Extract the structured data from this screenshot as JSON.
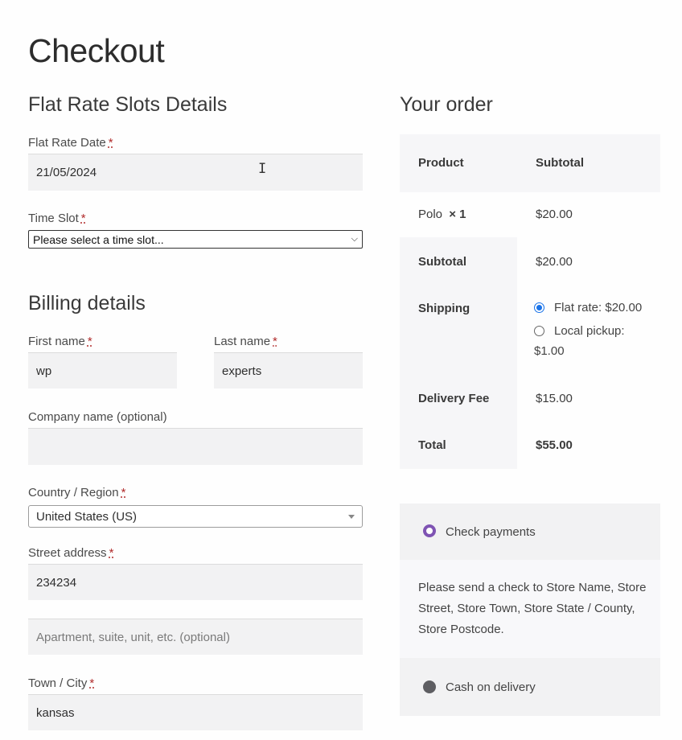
{
  "page": {
    "title": "Checkout"
  },
  "slots": {
    "heading": "Flat Rate Slots Details",
    "date_label": "Flat Rate Date",
    "date_value": "21/05/2024",
    "time_label": "Time Slot",
    "time_selected": "Please select a time slot...",
    "required_mark": "*"
  },
  "billing": {
    "heading": "Billing details",
    "first_name_label": "First name",
    "first_name_value": "wp",
    "last_name_label": "Last name",
    "last_name_value": "experts",
    "company_label": "Company name (optional)",
    "company_value": "",
    "country_label": "Country / Region",
    "country_value": "United States (US)",
    "street_label": "Street address",
    "street_value": "234234",
    "apartment_placeholder": "Apartment, suite, unit, etc. (optional)",
    "city_label": "Town / City",
    "city_value": "kansas"
  },
  "order": {
    "heading": "Your order",
    "col_product": "Product",
    "col_subtotal": "Subtotal",
    "item_name": "Polo",
    "item_qty": "× 1",
    "item_price": "$20.00",
    "subtotal_label": "Subtotal",
    "subtotal_value": "$20.00",
    "shipping_label": "Shipping",
    "shipping_option_1": "Flat rate: $20.00",
    "shipping_option_2_line1": "Local pickup:",
    "shipping_option_2_line2": "$1.00",
    "fee_label": "Delivery Fee",
    "fee_value": "$15.00",
    "total_label": "Total",
    "total_value": "$55.00"
  },
  "payment": {
    "check_label": "Check payments",
    "check_desc_1": "Please send a check to Store Name, Store",
    "check_desc_2": "Street, Store Town, Store State / County,",
    "check_desc_3": "Store Postcode.",
    "cod_label": "Cash on delivery"
  },
  "colors": {
    "accent_blue": "#1a73e8",
    "payment_purple": "#7f54b3",
    "field_bg": "#f2f2f3",
    "panel_bg": "#f6f6f8"
  }
}
